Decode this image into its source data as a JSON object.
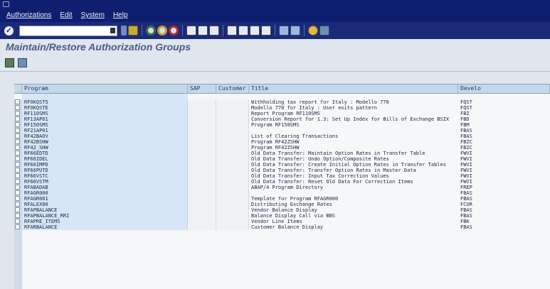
{
  "menubar": {
    "menus": [
      "Authorizations",
      "Edit",
      "System",
      "Help"
    ]
  },
  "toolbar": {
    "command_value": "",
    "icons": [
      "enter-icon",
      "save-icon",
      "back-icon",
      "exit-icon",
      "cancel-icon",
      "print-icon",
      "find-icon",
      "find-next-icon",
      "first-page-icon",
      "previous-page-icon",
      "next-page-icon",
      "last-page-icon",
      "create-session-icon",
      "shortcut-icon",
      "help-icon",
      "layout-icon"
    ]
  },
  "app": {
    "title": "Maintain/Restore Authorization Groups"
  },
  "table": {
    "headers": {
      "program": "Program",
      "sap": "SAP",
      "customer": "Customer",
      "title": "Title",
      "dev": "Develo"
    },
    "rows": [
      {
        "program": "RFOKQST5",
        "title": "Withholding tax report for Italy : Modello 770",
        "dev": "FQST"
      },
      {
        "program": "RFOKQSTE",
        "title": "Modello 770 for Italy : User exits pattern",
        "dev": "FQST"
      },
      {
        "program": "RF110SMS",
        "title": "Report Program RF110SMS",
        "dev": "FBZ"
      },
      {
        "program": "RF13AP01",
        "title": "Conversion Report for 1.3: Set Up Index for Bills of Exchange BSIX",
        "dev": "FBD"
      },
      {
        "program": "RF150SMS",
        "title": "Program RF150SMS",
        "dev": "FBM"
      },
      {
        "program": "RF21AP01",
        "title": "",
        "dev": "FBAS"
      },
      {
        "program": "RF42BAOV",
        "title": "List of Clearing Transactions",
        "dev": "FBAS"
      },
      {
        "program": "RF42BSHW",
        "title": "Program RF42ZSHW",
        "dev": "FBZC"
      },
      {
        "program": "RF42_SHW",
        "title": "Program RF42ZSHW",
        "dev": "FBZC"
      },
      {
        "program": "RF66EDTD",
        "title": "Old Data Transfer: Maintain Option Rates in Transfer Table",
        "dev": "FWVI"
      },
      {
        "program": "RF66IDEL",
        "title": "Old Data Transfer: Undo Option/Composite Rates",
        "dev": "FWVI"
      },
      {
        "program": "RF66IMPD",
        "title": "Old Data Transfer: Create Initial Option Rates in Transfer Tables",
        "dev": "FWVI"
      },
      {
        "program": "RF66PUTD",
        "title": "Old Data Transfer: Transfer Option Rates in Master Data",
        "dev": "FWVI"
      },
      {
        "program": "RF66VSTC",
        "title": "Old Data Transfer: Input Tax Correction Values",
        "dev": "FWVI"
      },
      {
        "program": "RF66VSTM",
        "title": "Old Data Transfer: Reset Old Data For Correction Items",
        "dev": "FWVI"
      },
      {
        "program": "RFABADAB",
        "title": "ABAP/4 Program Directory",
        "dev": "FREP"
      },
      {
        "program": "RFAGR000",
        "title": "",
        "dev": "FBAS"
      },
      {
        "program": "RFAGR001",
        "title": "Template for Program RFAGR000",
        "dev": "FBAS"
      },
      {
        "program": "RFALEX00",
        "title": "Distributing Exchange Rates",
        "dev": "FCUR"
      },
      {
        "program": "RFAPBALANCE",
        "title": "Vendor Balance Display",
        "dev": "FBAS"
      },
      {
        "program": "RFAPBALANCE_RRI",
        "title": "Balance Display Call via BBS",
        "dev": "FBAS"
      },
      {
        "program": "RFAPRE_ITEMS",
        "title": "Vendor Line Items",
        "dev": "FBK"
      },
      {
        "program": "RFARBALANCE",
        "title": "Customer Balance Display",
        "dev": "FBAS"
      }
    ]
  }
}
